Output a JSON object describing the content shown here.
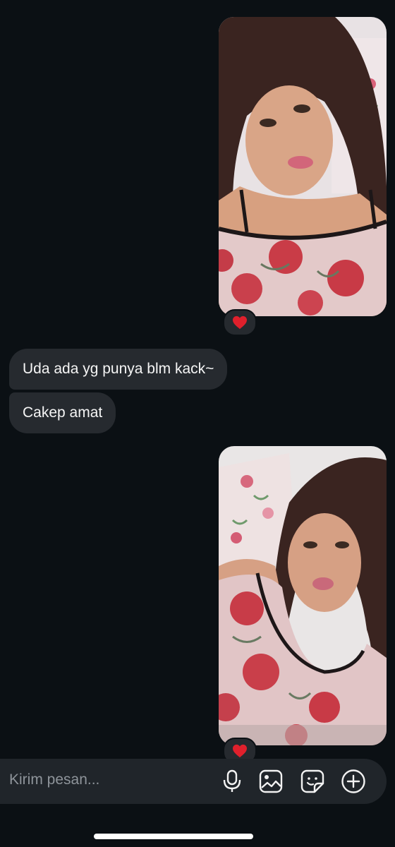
{
  "thread": {
    "messages": [
      {
        "kind": "photo",
        "direction": "outgoing",
        "reaction": "❤️"
      },
      {
        "kind": "text",
        "direction": "incoming",
        "text": "Uda ada yg punya blm kack~"
      },
      {
        "kind": "text",
        "direction": "incoming",
        "text": "Cakep amat"
      },
      {
        "kind": "photo",
        "direction": "outgoing",
        "reaction": "❤️"
      }
    ]
  },
  "composer": {
    "placeholder": "Kirim pesan...",
    "icons": [
      "microphone-icon",
      "gallery-icon",
      "sticker-icon",
      "plus-icon"
    ]
  },
  "colors": {
    "background": "#0b1014",
    "bubble": "#262a2f",
    "composer": "#20252a",
    "reaction_heart": "#e0202c"
  }
}
